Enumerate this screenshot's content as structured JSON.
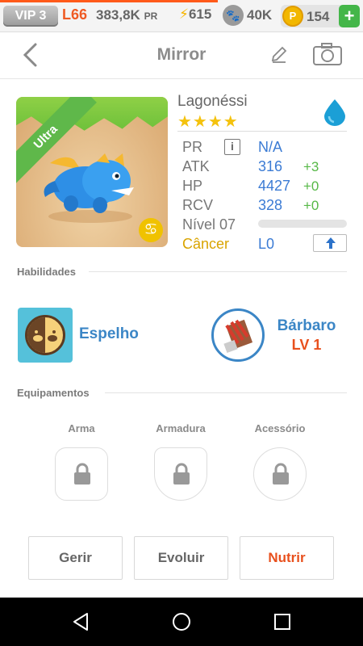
{
  "topbar": {
    "vip": "VIP 3",
    "level": "L66",
    "power": "383,8K",
    "power_unit": "PR",
    "energy": "615",
    "paws": "40K",
    "coins": "154",
    "coin_symbol": "P",
    "add_label": "+",
    "progress": 0.6
  },
  "header": {
    "title": "Mirror"
  },
  "monster": {
    "name": "Lagonéssi",
    "rarity": "Ultra",
    "stars": "★★★★",
    "element": "water",
    "stats": {
      "pr_label": "PR",
      "pr_value": "N/A",
      "atk_label": "ATK",
      "atk_value": "316",
      "atk_bonus": "+3",
      "hp_label": "HP",
      "hp_value": "4427",
      "hp_bonus": "+0",
      "rcv_label": "RCV",
      "rcv_value": "328",
      "rcv_bonus": "+0",
      "level_label": "Nível 07",
      "zodiac": "Câncer",
      "zodiac_symbol": "♋",
      "luck": "L0",
      "info_label": "i"
    }
  },
  "sections": {
    "skills": "Habilidades",
    "equipment": "Equipamentos"
  },
  "skills": [
    {
      "name": "Espelho"
    },
    {
      "name": "Bárbaro",
      "level": "LV 1"
    }
  ],
  "equipment": [
    {
      "label": "Arma"
    },
    {
      "label": "Armadura"
    },
    {
      "label": "Acessório"
    }
  ],
  "actions": {
    "manage": "Gerir",
    "evolve": "Evoluir",
    "feed": "Nutrir"
  },
  "colors": {
    "accent_orange": "#e8501d",
    "stat_blue": "#3b7bd4",
    "bonus_green": "#57b847",
    "zodiac_gold": "#d9a400"
  }
}
